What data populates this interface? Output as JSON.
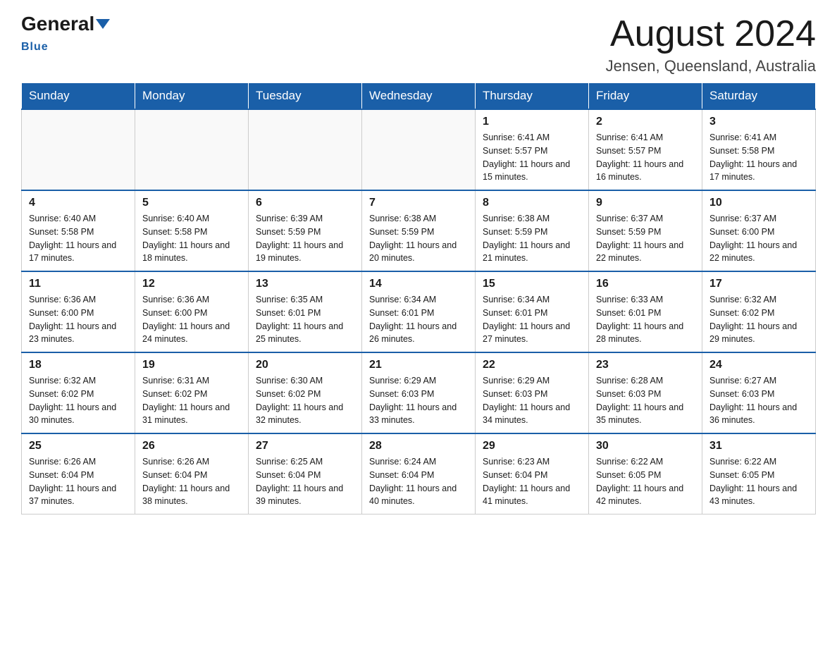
{
  "logo": {
    "general": "General",
    "arrow": "▶",
    "blue": "Blue"
  },
  "title": "August 2024",
  "location": "Jensen, Queensland, Australia",
  "days_of_week": [
    "Sunday",
    "Monday",
    "Tuesday",
    "Wednesday",
    "Thursday",
    "Friday",
    "Saturday"
  ],
  "weeks": [
    [
      {
        "day": "",
        "info": ""
      },
      {
        "day": "",
        "info": ""
      },
      {
        "day": "",
        "info": ""
      },
      {
        "day": "",
        "info": ""
      },
      {
        "day": "1",
        "info": "Sunrise: 6:41 AM\nSunset: 5:57 PM\nDaylight: 11 hours and 15 minutes."
      },
      {
        "day": "2",
        "info": "Sunrise: 6:41 AM\nSunset: 5:57 PM\nDaylight: 11 hours and 16 minutes."
      },
      {
        "day": "3",
        "info": "Sunrise: 6:41 AM\nSunset: 5:58 PM\nDaylight: 11 hours and 17 minutes."
      }
    ],
    [
      {
        "day": "4",
        "info": "Sunrise: 6:40 AM\nSunset: 5:58 PM\nDaylight: 11 hours and 17 minutes."
      },
      {
        "day": "5",
        "info": "Sunrise: 6:40 AM\nSunset: 5:58 PM\nDaylight: 11 hours and 18 minutes."
      },
      {
        "day": "6",
        "info": "Sunrise: 6:39 AM\nSunset: 5:59 PM\nDaylight: 11 hours and 19 minutes."
      },
      {
        "day": "7",
        "info": "Sunrise: 6:38 AM\nSunset: 5:59 PM\nDaylight: 11 hours and 20 minutes."
      },
      {
        "day": "8",
        "info": "Sunrise: 6:38 AM\nSunset: 5:59 PM\nDaylight: 11 hours and 21 minutes."
      },
      {
        "day": "9",
        "info": "Sunrise: 6:37 AM\nSunset: 5:59 PM\nDaylight: 11 hours and 22 minutes."
      },
      {
        "day": "10",
        "info": "Sunrise: 6:37 AM\nSunset: 6:00 PM\nDaylight: 11 hours and 22 minutes."
      }
    ],
    [
      {
        "day": "11",
        "info": "Sunrise: 6:36 AM\nSunset: 6:00 PM\nDaylight: 11 hours and 23 minutes."
      },
      {
        "day": "12",
        "info": "Sunrise: 6:36 AM\nSunset: 6:00 PM\nDaylight: 11 hours and 24 minutes."
      },
      {
        "day": "13",
        "info": "Sunrise: 6:35 AM\nSunset: 6:01 PM\nDaylight: 11 hours and 25 minutes."
      },
      {
        "day": "14",
        "info": "Sunrise: 6:34 AM\nSunset: 6:01 PM\nDaylight: 11 hours and 26 minutes."
      },
      {
        "day": "15",
        "info": "Sunrise: 6:34 AM\nSunset: 6:01 PM\nDaylight: 11 hours and 27 minutes."
      },
      {
        "day": "16",
        "info": "Sunrise: 6:33 AM\nSunset: 6:01 PM\nDaylight: 11 hours and 28 minutes."
      },
      {
        "day": "17",
        "info": "Sunrise: 6:32 AM\nSunset: 6:02 PM\nDaylight: 11 hours and 29 minutes."
      }
    ],
    [
      {
        "day": "18",
        "info": "Sunrise: 6:32 AM\nSunset: 6:02 PM\nDaylight: 11 hours and 30 minutes."
      },
      {
        "day": "19",
        "info": "Sunrise: 6:31 AM\nSunset: 6:02 PM\nDaylight: 11 hours and 31 minutes."
      },
      {
        "day": "20",
        "info": "Sunrise: 6:30 AM\nSunset: 6:02 PM\nDaylight: 11 hours and 32 minutes."
      },
      {
        "day": "21",
        "info": "Sunrise: 6:29 AM\nSunset: 6:03 PM\nDaylight: 11 hours and 33 minutes."
      },
      {
        "day": "22",
        "info": "Sunrise: 6:29 AM\nSunset: 6:03 PM\nDaylight: 11 hours and 34 minutes."
      },
      {
        "day": "23",
        "info": "Sunrise: 6:28 AM\nSunset: 6:03 PM\nDaylight: 11 hours and 35 minutes."
      },
      {
        "day": "24",
        "info": "Sunrise: 6:27 AM\nSunset: 6:03 PM\nDaylight: 11 hours and 36 minutes."
      }
    ],
    [
      {
        "day": "25",
        "info": "Sunrise: 6:26 AM\nSunset: 6:04 PM\nDaylight: 11 hours and 37 minutes."
      },
      {
        "day": "26",
        "info": "Sunrise: 6:26 AM\nSunset: 6:04 PM\nDaylight: 11 hours and 38 minutes."
      },
      {
        "day": "27",
        "info": "Sunrise: 6:25 AM\nSunset: 6:04 PM\nDaylight: 11 hours and 39 minutes."
      },
      {
        "day": "28",
        "info": "Sunrise: 6:24 AM\nSunset: 6:04 PM\nDaylight: 11 hours and 40 minutes."
      },
      {
        "day": "29",
        "info": "Sunrise: 6:23 AM\nSunset: 6:04 PM\nDaylight: 11 hours and 41 minutes."
      },
      {
        "day": "30",
        "info": "Sunrise: 6:22 AM\nSunset: 6:05 PM\nDaylight: 11 hours and 42 minutes."
      },
      {
        "day": "31",
        "info": "Sunrise: 6:22 AM\nSunset: 6:05 PM\nDaylight: 11 hours and 43 minutes."
      }
    ]
  ]
}
